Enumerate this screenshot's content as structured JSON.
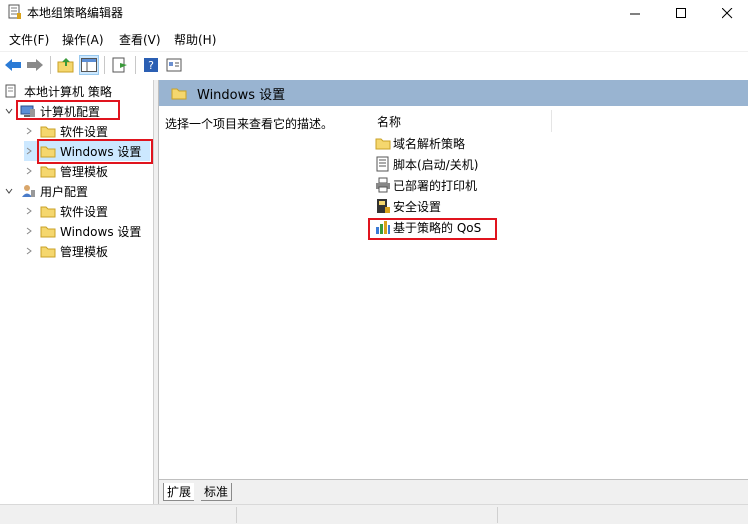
{
  "window": {
    "title": "本地组策略编辑器",
    "minimize_icon": "minimize-icon",
    "maximize_icon": "maximize-icon",
    "close_icon": "close-icon"
  },
  "menu": [
    "文件(F)",
    "操作(A)",
    "查看(V)",
    "帮助(H)"
  ],
  "toolbar": [
    "back-arrow-icon",
    "forward-arrow-icon",
    "up-folder-icon",
    "show-hide-tree-icon",
    "export-list-icon",
    "help-icon",
    "properties-icon"
  ],
  "tree": {
    "root": "本地计算机 策略",
    "computer_config": "计算机配置",
    "computer_children": [
      "软件设置",
      "Windows 设置",
      "管理模板"
    ],
    "user_config": "用户配置",
    "user_children": [
      "软件设置",
      "Windows 设置",
      "管理模板"
    ]
  },
  "right": {
    "header_title": "Windows 设置",
    "description": "选择一个项目来查看它的描述。",
    "column_name": "名称",
    "items": [
      "域名解析策略",
      "脚本(启动/关机)",
      "已部署的打印机",
      "安全设置",
      "基于策略的 QoS"
    ]
  },
  "tabs": [
    "扩展",
    "标准"
  ],
  "colors": {
    "header_bar": "#99b4d1",
    "selection": "#cce8ff",
    "highlight_box": "#e0141e",
    "folder": "#f5d76e"
  }
}
